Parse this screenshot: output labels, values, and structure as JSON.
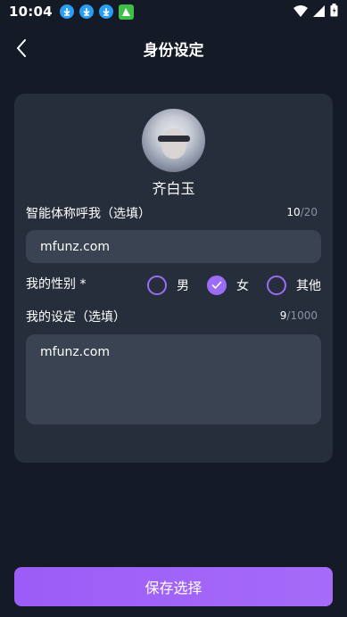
{
  "status_bar": {
    "time": "10:04"
  },
  "header": {
    "title": "身份设定"
  },
  "card": {
    "character_name": "齐白玉",
    "nickname": {
      "label": "智能体称呼我（选填）",
      "count": "10",
      "max": "/20",
      "value": "mfunz.com"
    },
    "gender": {
      "label": "我的性别 *",
      "options": [
        {
          "label": "男",
          "checked": false
        },
        {
          "label": "女",
          "checked": true
        },
        {
          "label": "其他",
          "checked": false
        }
      ]
    },
    "setting": {
      "label": "我的设定（选填）",
      "count": "9",
      "max": "/1000",
      "value": "mfunz.com"
    }
  },
  "footer": {
    "save_label": "保存选择"
  },
  "colors": {
    "accent": "#9b6cf5",
    "background": "#141a26",
    "card": "#262e3b",
    "input": "#3a4351"
  }
}
